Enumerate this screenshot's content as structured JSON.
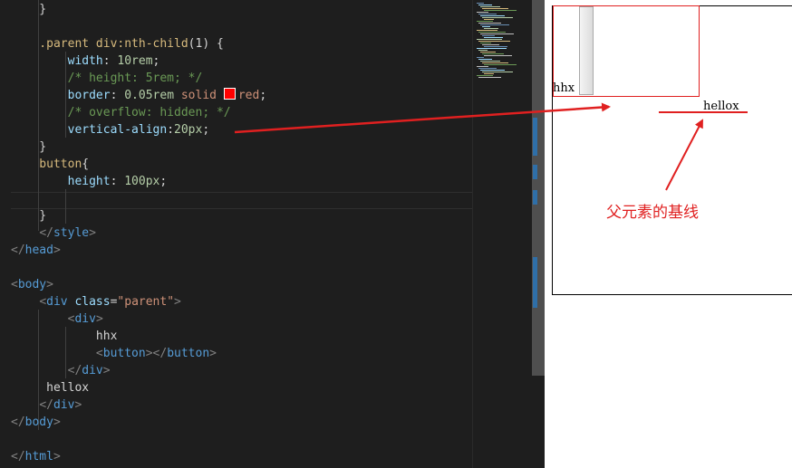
{
  "editor": {
    "lines": [
      [
        {
          "t": "    }",
          "c": "punc"
        }
      ],
      [],
      [
        {
          "t": "    .parent div:nth-child",
          "c": "sel"
        },
        {
          "t": "(1)",
          "c": "punc"
        },
        {
          "t": " {",
          "c": "punc"
        }
      ],
      [
        {
          "t": "        width",
          "c": "prop"
        },
        {
          "t": ": ",
          "c": "punc"
        },
        {
          "t": "10rem",
          "c": "num"
        },
        {
          "t": ";",
          "c": "punc"
        }
      ],
      [
        {
          "t": "        /* height: 5rem; */",
          "c": "com"
        }
      ],
      [
        {
          "t": "        border",
          "c": "prop"
        },
        {
          "t": ": ",
          "c": "punc"
        },
        {
          "t": "0.05rem",
          "c": "num"
        },
        {
          "t": " solid ",
          "c": "val"
        },
        {
          "t": "",
          "c": "swatch"
        },
        {
          "t": "red",
          "c": "val"
        },
        {
          "t": ";",
          "c": "punc"
        }
      ],
      [
        {
          "t": "        /* overflow: hidden; */",
          "c": "com"
        }
      ],
      [
        {
          "t": "        vertical-align",
          "c": "prop"
        },
        {
          "t": ":",
          "c": "punc"
        },
        {
          "t": "20px",
          "c": "num"
        },
        {
          "t": ";",
          "c": "punc"
        }
      ],
      [
        {
          "t": "    }",
          "c": "punc"
        }
      ],
      [
        {
          "t": "    button",
          "c": "sel"
        },
        {
          "t": "{",
          "c": "punc"
        }
      ],
      [
        {
          "t": "        height",
          "c": "prop"
        },
        {
          "t": ": ",
          "c": "punc"
        },
        {
          "t": "100px",
          "c": "num"
        },
        {
          "t": ";",
          "c": "punc"
        }
      ],
      [],
      [
        {
          "t": "    }",
          "c": "punc"
        }
      ],
      [
        {
          "t": "    ",
          "c": "txt"
        },
        {
          "t": "</",
          "c": "brk"
        },
        {
          "t": "style",
          "c": "tag"
        },
        {
          "t": ">",
          "c": "brk"
        }
      ],
      [
        {
          "t": "</",
          "c": "brk"
        },
        {
          "t": "head",
          "c": "tag"
        },
        {
          "t": ">",
          "c": "brk"
        }
      ],
      [],
      [
        {
          "t": "<",
          "c": "brk"
        },
        {
          "t": "body",
          "c": "tag"
        },
        {
          "t": ">",
          "c": "brk"
        }
      ],
      [
        {
          "t": "    ",
          "c": "txt"
        },
        {
          "t": "<",
          "c": "brk"
        },
        {
          "t": "div",
          "c": "tag"
        },
        {
          "t": " class",
          "c": "attr"
        },
        {
          "t": "=",
          "c": "punc"
        },
        {
          "t": "\"parent\"",
          "c": "str"
        },
        {
          "t": ">",
          "c": "brk"
        }
      ],
      [
        {
          "t": "        ",
          "c": "txt"
        },
        {
          "t": "<",
          "c": "brk"
        },
        {
          "t": "div",
          "c": "tag"
        },
        {
          "t": ">",
          "c": "brk"
        }
      ],
      [
        {
          "t": "            hhx",
          "c": "txt"
        }
      ],
      [
        {
          "t": "            ",
          "c": "txt"
        },
        {
          "t": "<",
          "c": "brk"
        },
        {
          "t": "button",
          "c": "tag"
        },
        {
          "t": "></",
          "c": "brk"
        },
        {
          "t": "button",
          "c": "tag"
        },
        {
          "t": ">",
          "c": "brk"
        }
      ],
      [
        {
          "t": "        ",
          "c": "txt"
        },
        {
          "t": "</",
          "c": "brk"
        },
        {
          "t": "div",
          "c": "tag"
        },
        {
          "t": ">",
          "c": "brk"
        }
      ],
      [
        {
          "t": "     hellox",
          "c": "txt"
        }
      ],
      [
        {
          "t": "    ",
          "c": "txt"
        },
        {
          "t": "</",
          "c": "brk"
        },
        {
          "t": "div",
          "c": "tag"
        },
        {
          "t": ">",
          "c": "brk"
        }
      ],
      [
        {
          "t": "</",
          "c": "brk"
        },
        {
          "t": "body",
          "c": "tag"
        },
        {
          "t": ">",
          "c": "brk"
        }
      ],
      [],
      [
        {
          "t": "</",
          "c": "brk"
        },
        {
          "t": "html",
          "c": "tag"
        },
        {
          "t": ">",
          "c": "brk"
        }
      ]
    ]
  },
  "preview": {
    "child_text": "hhx",
    "parent_text": "hellox",
    "annotation": "父元素的基线"
  },
  "colors": {
    "editor_bg": "#1e1e1e",
    "annotation_red": "#e02020",
    "selector": "#d7ba7d",
    "property": "#9cdcfe",
    "number": "#b5cea8",
    "comment": "#6a9955",
    "tag": "#569cd6"
  }
}
